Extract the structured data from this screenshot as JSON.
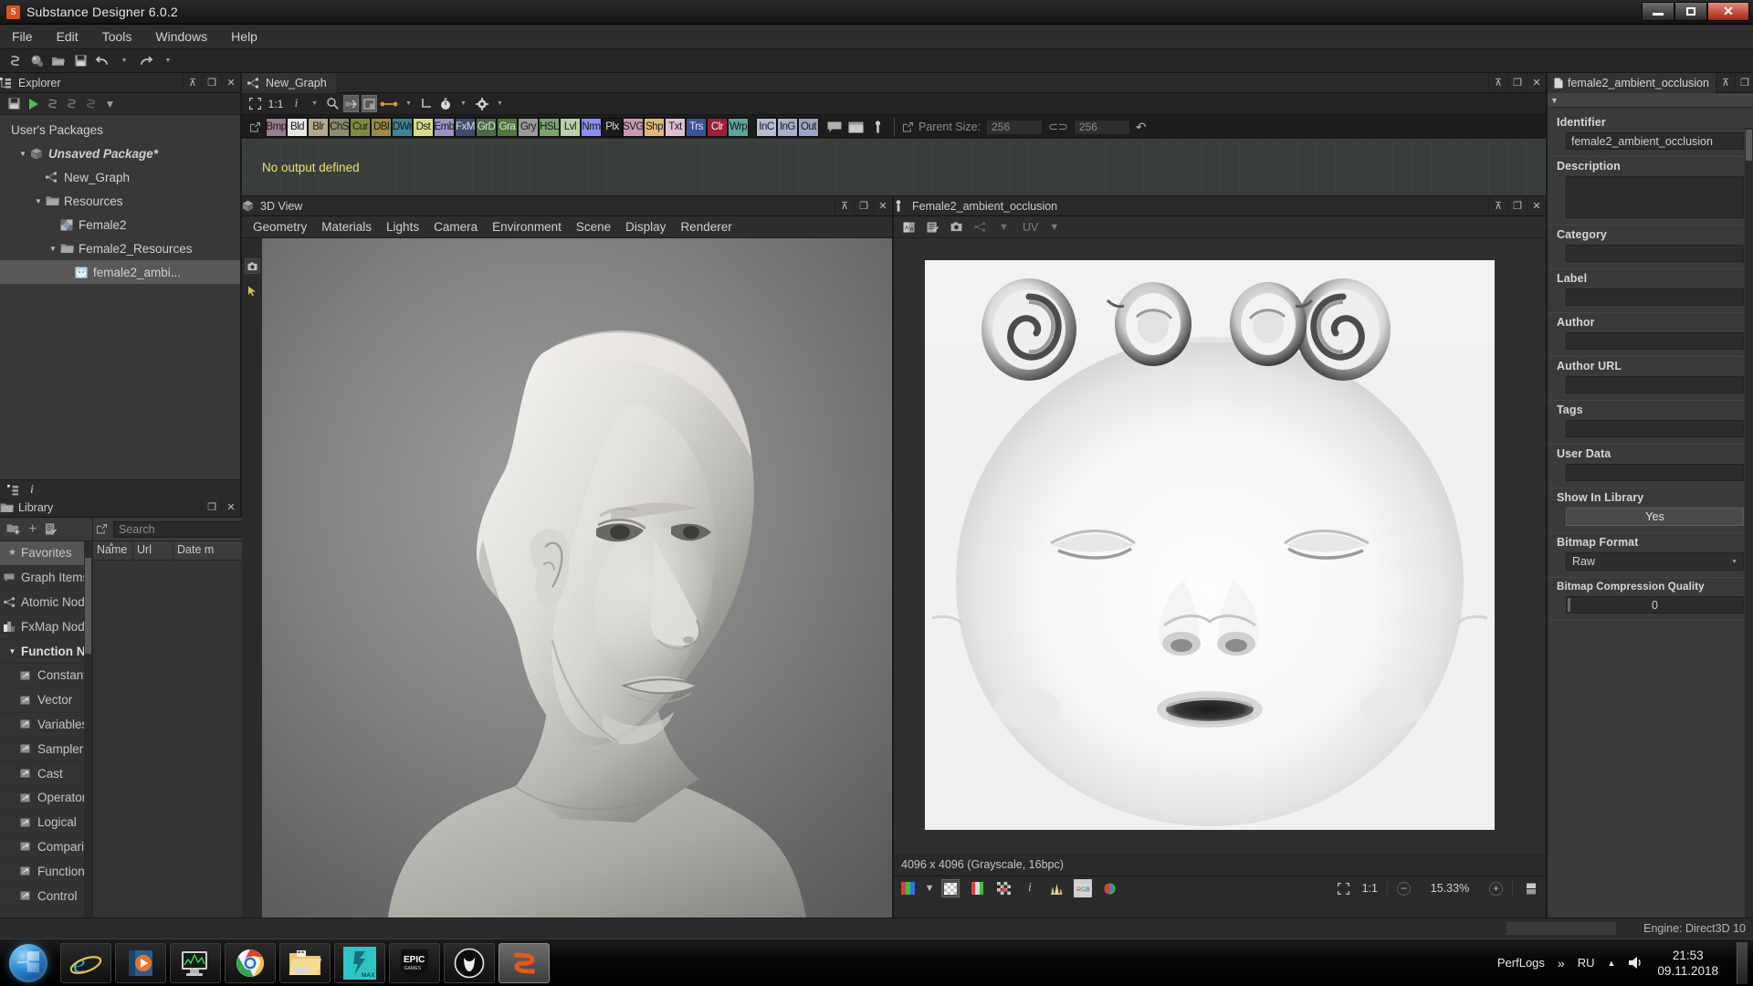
{
  "window": {
    "title": "Substance Designer 6.0.2",
    "app_icon": "substance-logo-icon",
    "minimize": "—",
    "maximize": "❐",
    "close": "✕"
  },
  "menubar": {
    "items": [
      "File",
      "Edit",
      "Tools",
      "Windows",
      "Help"
    ]
  },
  "main_toolbar": {
    "icons": [
      "new-substance-icon",
      "new-material-icon",
      "open-package-icon",
      "save-package-icon",
      "undo-icon",
      "undo-dropdown-icon",
      "redo-icon",
      "redo-dropdown-icon"
    ]
  },
  "explorer": {
    "title": "Explorer",
    "title_icon": "explorer-tree-icon",
    "toolbar_icons": [
      "save-icon",
      "run-icon",
      "substance-new-icon",
      "substance-import-icon",
      "substance-link-icon",
      "dropdown-icon"
    ],
    "tree": [
      {
        "label": "User's Packages",
        "depth": 0,
        "arrow": "",
        "icon": "",
        "bold": false,
        "selected": false
      },
      {
        "label": "Unsaved Package*",
        "depth": 1,
        "arrow": "▼",
        "icon": "package-icon",
        "bold": true,
        "selected": false
      },
      {
        "label": "New_Graph",
        "depth": 2,
        "arrow": "",
        "icon": "graph-icon",
        "bold": false,
        "selected": false
      },
      {
        "label": "Resources",
        "depth": 2,
        "arrow": "▼",
        "icon": "folder-icon",
        "bold": false,
        "selected": false
      },
      {
        "label": "Female2",
        "depth": 3,
        "arrow": "",
        "icon": "mesh-icon",
        "bold": false,
        "selected": false
      },
      {
        "label": "Female2_Resources",
        "depth": 3,
        "arrow": "▼",
        "icon": "folder-icon",
        "bold": false,
        "selected": false
      },
      {
        "label": "female2_ambi...",
        "depth": 4,
        "arrow": "",
        "icon": "bitmap-icon",
        "bold": false,
        "selected": true
      }
    ],
    "bottom_icons": [
      "explorer-tree-icon",
      "info-icon"
    ]
  },
  "library": {
    "title": "Library",
    "title_icon": "folder-open-icon",
    "toolbar_icons": [
      "add-library-icon",
      "plus-icon",
      "edit-list-icon"
    ],
    "search_placeholder": "Search",
    "search_value": "",
    "expand_icon": "»",
    "columns": [
      "Name",
      "Url",
      "Date m"
    ],
    "categories": [
      {
        "label": "Favorites",
        "icon": "star-icon",
        "selected": true,
        "sub": false,
        "bold": false,
        "arrow": ""
      },
      {
        "label": "Graph Items",
        "icon": "comment-icon",
        "selected": false,
        "sub": false,
        "bold": false,
        "arrow": ""
      },
      {
        "label": "Atomic Node",
        "icon": "atomic-icon",
        "selected": false,
        "sub": false,
        "bold": false,
        "arrow": ""
      },
      {
        "label": "FxMap Node",
        "icon": "fxmap-icon",
        "selected": false,
        "sub": false,
        "bold": false,
        "arrow": ""
      },
      {
        "label": "Function N..",
        "icon": "",
        "selected": false,
        "sub": false,
        "bold": true,
        "arrow": "▼"
      },
      {
        "label": "Constant",
        "icon": "func-icon",
        "selected": false,
        "sub": true,
        "bold": false,
        "arrow": ""
      },
      {
        "label": "Vector",
        "icon": "func-icon",
        "selected": false,
        "sub": true,
        "bold": false,
        "arrow": ""
      },
      {
        "label": "Variables",
        "icon": "func-icon",
        "selected": false,
        "sub": true,
        "bold": false,
        "arrow": ""
      },
      {
        "label": "Samplers",
        "icon": "func-icon",
        "selected": false,
        "sub": true,
        "bold": false,
        "arrow": ""
      },
      {
        "label": "Cast",
        "icon": "func-icon",
        "selected": false,
        "sub": true,
        "bold": false,
        "arrow": ""
      },
      {
        "label": "Operator",
        "icon": "func-icon",
        "selected": false,
        "sub": true,
        "bold": false,
        "arrow": ""
      },
      {
        "label": "Logical",
        "icon": "func-icon",
        "selected": false,
        "sub": true,
        "bold": false,
        "arrow": ""
      },
      {
        "label": "Compari.",
        "icon": "func-icon",
        "selected": false,
        "sub": true,
        "bold": false,
        "arrow": ""
      },
      {
        "label": "Function",
        "icon": "func-icon",
        "selected": false,
        "sub": true,
        "bold": false,
        "arrow": ""
      },
      {
        "label": "Control",
        "icon": "func-icon",
        "selected": false,
        "sub": true,
        "bold": false,
        "arrow": ""
      }
    ]
  },
  "graph": {
    "tab_label": "New_Graph",
    "tab_icon": "graph-icon",
    "toolbar": {
      "fit_icon": "fit-view-icon",
      "ratio_label": "1:1",
      "info_icon": "info-icon",
      "search_icon": "search-icon",
      "link_icons": [
        "node-link-icon",
        "node-frame-icon"
      ],
      "connect_icon": "connection-icon",
      "angle_icon": "right-angle-icon",
      "timer_icon": "stopwatch-icon",
      "gear_icon": "gear-icon"
    },
    "node_chips": [
      {
        "label": "Bmp",
        "color": "#9b7d90"
      },
      {
        "label": "Bld",
        "color": "#e8e8e4"
      },
      {
        "label": "Blr",
        "color": "#b6a98a"
      },
      {
        "label": "ChS",
        "color": "#8d8d6d"
      },
      {
        "label": "Cur",
        "color": "#7f8a3d"
      },
      {
        "label": "DBl",
        "color": "#9c8a48"
      },
      {
        "label": "DWr",
        "color": "#3d8494"
      },
      {
        "label": "Dst",
        "color": "#d6dc8a"
      },
      {
        "label": "Emb",
        "color": "#9b93c8"
      },
      {
        "label": "FxM",
        "color": "#3f4c6a"
      },
      {
        "label": "GrD",
        "color": "#4a6b43"
      },
      {
        "label": "Gra",
        "color": "#4f7a3a"
      },
      {
        "label": "Gry",
        "color": "#9a9a9a"
      },
      {
        "label": "HSL",
        "color": "#7ba470"
      },
      {
        "label": "Lvl",
        "color": "#b9d1a8"
      },
      {
        "label": "Nrm",
        "color": "#8a8ef0"
      },
      {
        "label": "Plx",
        "color": "#1b1b1b"
      },
      {
        "label": "SVG",
        "color": "#c79ab0"
      },
      {
        "label": "Shp",
        "color": "#e0b97a"
      },
      {
        "label": "Txt",
        "color": "#e0bfd4"
      },
      {
        "label": "Trs",
        "color": "#3a53a0"
      },
      {
        "label": "Clr",
        "color": "#9c2036"
      },
      {
        "label": "Wrp",
        "color": "#5aa7a0"
      }
    ],
    "io_chips": [
      {
        "label": "InC",
        "color": "#b5bdd4"
      },
      {
        "label": "InG",
        "color": "#a7b0cb"
      },
      {
        "label": "Out",
        "color": "#9aa4c3"
      }
    ],
    "misc_icons": [
      "comment-icon",
      "frame-icon",
      "pin-icon"
    ],
    "parent_size": {
      "link_icon": "external-link-icon",
      "label": "Parent Size:",
      "width": "256",
      "chain_icon": "chain-link-icon",
      "height": "256",
      "reset_icon": "reset-icon"
    },
    "canvas_message": "No output defined"
  },
  "view3d": {
    "title": "3D View",
    "title_icon": "cube-icon",
    "menu": [
      "Geometry",
      "Materials",
      "Lights",
      "Camera",
      "Environment",
      "Scene",
      "Display",
      "Renderer"
    ],
    "side_tools": [
      "screenshot-icon",
      "pointer-icon"
    ],
    "panel_buttons": [
      "maximize-icon",
      "float-icon",
      "close-icon"
    ]
  },
  "view2d": {
    "title": "Female2_ambient_occlusion",
    "title_icon": "bitmap-icon",
    "toolbar_icons": [
      "compare-icon",
      "edit-icon",
      "snapshot-icon",
      "graph-link-icon"
    ],
    "uv_label": "UV",
    "image_info": "4096 x 4096 (Grayscale, 16bpc)",
    "bottom_icons": [
      "channels-icon",
      "channels-dropdown-icon",
      "alpha-icon",
      "rgb-strip-icon",
      "mask-icon",
      "info-icon",
      "histogram-icon",
      "rgb-label-icon",
      "color-wheel-icon"
    ],
    "fit_icon": "fit-view-icon",
    "ratio_label": "1:1",
    "zoom_out_icon": "minus-icon",
    "zoom_level": "15.33%",
    "zoom_in_icon": "plus-icon",
    "tile_icon": "tile-icon",
    "panel_buttons": [
      "maximize-icon",
      "float-icon",
      "close-icon"
    ]
  },
  "properties": {
    "tab_label": "female2_ambient_occlusion",
    "tab_icon": "file-icon",
    "collapse_icon": "▼",
    "fields": [
      {
        "label": "Identifier",
        "type": "text",
        "value": "female2_ambient_occlusion"
      },
      {
        "label": "Description",
        "type": "textarea",
        "value": ""
      },
      {
        "label": "Category",
        "type": "text",
        "value": ""
      },
      {
        "label": "Label",
        "type": "text",
        "value": ""
      },
      {
        "label": "Author",
        "type": "text",
        "value": ""
      },
      {
        "label": "Author URL",
        "type": "text",
        "value": ""
      },
      {
        "label": "Tags",
        "type": "text",
        "value": ""
      },
      {
        "label": "User Data",
        "type": "text",
        "value": ""
      },
      {
        "label": "Show In Library",
        "type": "button",
        "value": "Yes"
      },
      {
        "label": "Bitmap Format",
        "type": "select",
        "value": "Raw"
      },
      {
        "label": "Bitmap Compression Quality",
        "type": "slider",
        "value": "0"
      }
    ],
    "panel_buttons": [
      "maximize-icon",
      "float-icon",
      "close-icon"
    ]
  },
  "statusbar": {
    "left_icon": "explorer-tree-icon",
    "engine_text": "Engine: Direct3D 10"
  },
  "taskbar": {
    "start_icon": "windows-start-orb",
    "items": [
      {
        "name": "internet-explorer-icon",
        "active": false
      },
      {
        "name": "media-player-icon",
        "active": false
      },
      {
        "name": "system-monitor-icon",
        "active": false
      },
      {
        "name": "google-chrome-icon",
        "active": false
      },
      {
        "name": "file-explorer-icon",
        "active": false
      },
      {
        "name": "3ds-max-icon",
        "active": false
      },
      {
        "name": "epic-games-icon",
        "active": false
      },
      {
        "name": "unreal-engine-icon",
        "active": false
      },
      {
        "name": "substance-designer-icon",
        "active": true
      }
    ],
    "tray": {
      "perflogs_label": "PerfLogs",
      "overflow_icon": "»",
      "language": "RU",
      "show_hidden_icon": "▲",
      "volume_icon": "speaker-icon",
      "time": "21:53",
      "date": "09.11.2018"
    }
  }
}
